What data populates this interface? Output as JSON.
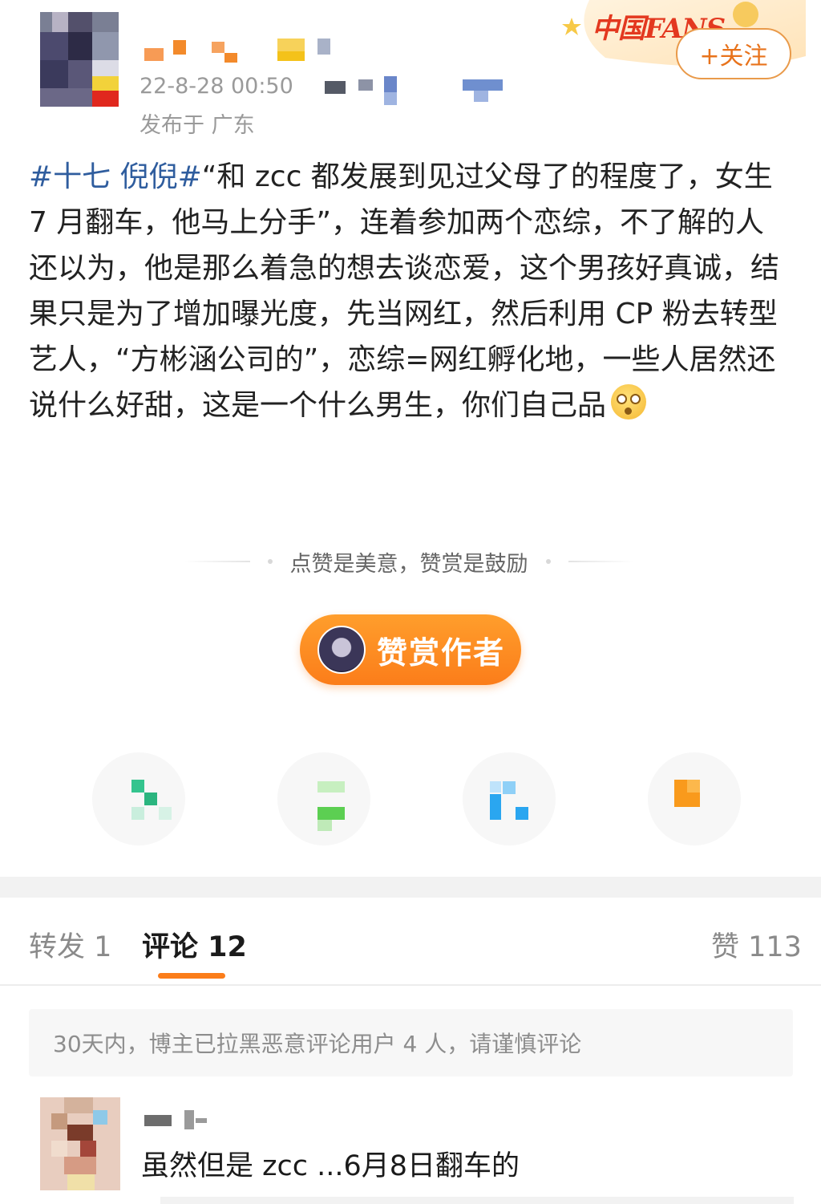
{
  "post": {
    "timestamp": "22-8-28 00:50",
    "location": "发布于 广东",
    "hashtag": "#十七 倪倪#",
    "text": "“和 zcc 都发展到见过父母了的程度了，女生 7 月翻车，他马上分手”，连着参加两个恋综，不了解的人还以为，他是那么着急的想去谈恋爱，这个男孩好真诚，结果只是为了增加曝光度，先当网红，然后利用 CP 粉去转型艺人，“方彬涵公司的”，恋综=网红孵化地，一些人居然还说什么好甜，这是一个什么男生，你们自己品",
    "emoji_icon": "dizzy-face-emoji"
  },
  "badge": {
    "text": "中国FANS"
  },
  "follow": {
    "label": "+关注"
  },
  "reward": {
    "tip": "点赞是美意，赞赏是鼓励",
    "button_label": "赞赏作者"
  },
  "tabs": {
    "repost": "转发 1",
    "comments": "评论 12",
    "likes": "赞 113"
  },
  "notice": "30天内，博主已拉黑恶意评论用户 4 人，请谨慎评论",
  "comment": {
    "text": "虽然但是 zcc ...6月8日翻车的"
  },
  "colors": {
    "accent": "#fb7d1a",
    "hashtag": "#2f5d9e",
    "follow_border": "#e99a4a"
  }
}
